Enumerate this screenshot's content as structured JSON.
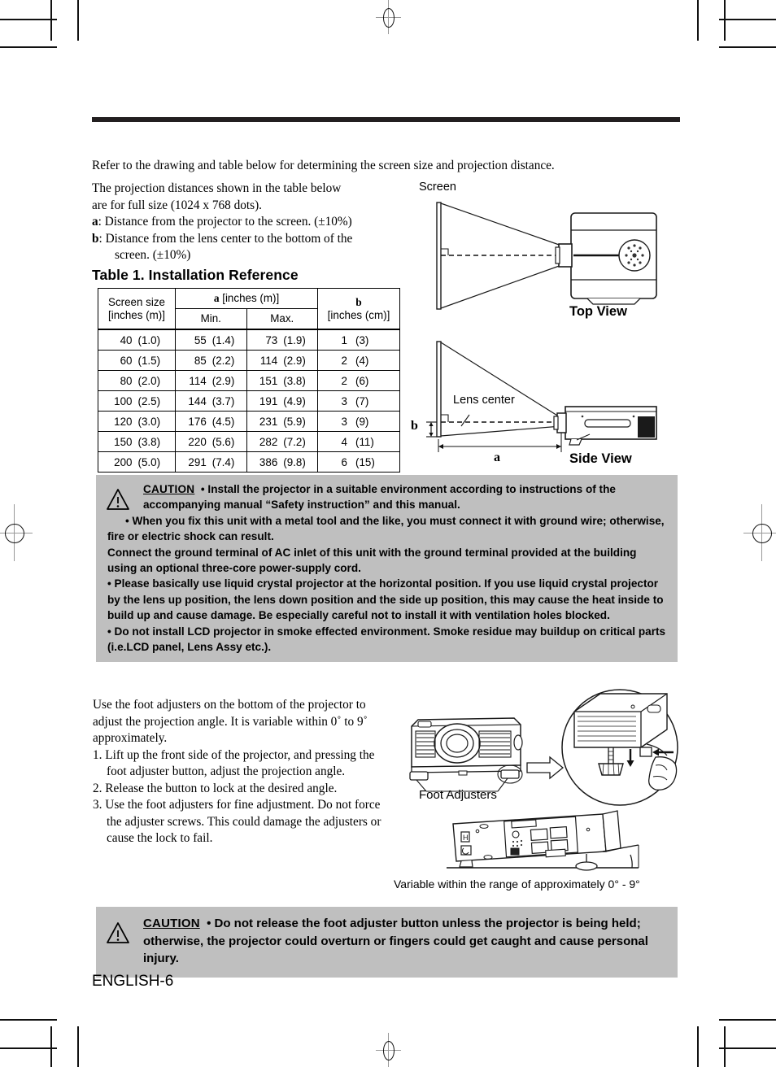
{
  "page": {
    "footer": "ENGLISH-6",
    "intro": "Refer to the drawing and table below for determining the screen size and projection distance."
  },
  "left_intro": {
    "line1": "The projection distances shown in the table below",
    "line2": "are for full size (1024 x 768 dots).",
    "a_label": "a",
    "a_desc": ": Distance from the projector to the screen. (±10%)",
    "b_label": "b",
    "b_desc": ": Distance from the lens center to the bottom of the",
    "b_desc2": "screen. (±10%)"
  },
  "table": {
    "title": "Table 1. Installation Reference",
    "headers": {
      "screen_size_line1": "Screen size",
      "screen_size_line2": "[inches (m)]",
      "a_group_bold": "a",
      "a_group_rest": " [inches (m)]",
      "min": "Min.",
      "max": "Max.",
      "b_bold": "b",
      "b_units": "[inches (cm)]"
    },
    "rows": [
      {
        "screen_n": "40",
        "screen_p": "(1.0)",
        "min_n": "55",
        "min_p": "(1.4)",
        "max_n": "73",
        "max_p": "(1.9)",
        "b_n": "1",
        "b_p": "(3)"
      },
      {
        "screen_n": "60",
        "screen_p": "(1.5)",
        "min_n": "85",
        "min_p": "(2.2)",
        "max_n": "114",
        "max_p": "(2.9)",
        "b_n": "2",
        "b_p": "(4)"
      },
      {
        "screen_n": "80",
        "screen_p": "(2.0)",
        "min_n": "114",
        "min_p": "(2.9)",
        "max_n": "151",
        "max_p": "(3.8)",
        "b_n": "2",
        "b_p": "(6)"
      },
      {
        "screen_n": "100",
        "screen_p": "(2.5)",
        "min_n": "144",
        "min_p": "(3.7)",
        "max_n": "191",
        "max_p": "(4.9)",
        "b_n": "3",
        "b_p": "(7)"
      },
      {
        "screen_n": "120",
        "screen_p": "(3.0)",
        "min_n": "176",
        "min_p": "(4.5)",
        "max_n": "231",
        "max_p": "(5.9)",
        "b_n": "3",
        "b_p": "(9)"
      },
      {
        "screen_n": "150",
        "screen_p": "(3.8)",
        "min_n": "220",
        "min_p": "(5.6)",
        "max_n": "282",
        "max_p": "(7.2)",
        "b_n": "4",
        "b_p": "(11)"
      },
      {
        "screen_n": "200",
        "screen_p": "(5.0)",
        "min_n": "291",
        "min_p": "(7.4)",
        "max_n": "386",
        "max_p": "(9.8)",
        "b_n": "6",
        "b_p": "(15)"
      }
    ]
  },
  "diagrams": {
    "screen_label": "Screen",
    "top_view": "Top View",
    "side_view": "Side View",
    "lens_center": "Lens center",
    "dim_a": "a",
    "dim_b": "b",
    "foot_adjusters": "Foot Adjusters",
    "variable_range": "Variable within the range of approximately 0° - 9°"
  },
  "caution_top": {
    "word": "CAUTION",
    "p1": "• Install the projector in a suitable environment according to instructions of the accompanying manual “Safety instruction” and this manual.",
    "p2": "• When you fix this unit with a metal tool and the like, you must connect it with ground wire; otherwise, fire or electric shock can result.",
    "p3": "Connect the ground terminal of AC inlet of this unit with the ground terminal provided at the building using an optional three-core power-supply cord.",
    "p4": "• Please basically use liquid crystal projector at the horizontal position. If you use liquid crystal projector by the lens up position, the lens down position and the side up position, this may cause the heat inside to build up and cause damage. Be especially careful not to install it with ventilation holes blocked.",
    "p5": "• Do not install LCD projector in smoke effected environment. Smoke residue may buildup on critical parts (i.e.LCD panel, Lens Assy etc.)."
  },
  "instructions": {
    "intro": "Use the foot adjusters on the bottom of the projector to adjust the projection angle. It is variable within 0˚ to 9˚ approximately.",
    "step1": "1. Lift up the front side of the projector, and pressing the foot adjuster button, adjust the projection angle.",
    "step2": "2. Release the button to lock at the desired angle.",
    "step3": "3. Use the foot adjusters for fine adjustment. Do not force the adjuster screws. This could damage the adjusters or cause the lock to fail."
  },
  "caution_bottom": {
    "word": "CAUTION",
    "p1": "• Do not release the foot adjuster button unless the projector is being held; otherwise, the projector could overturn or fingers could get caught and cause personal injury."
  },
  "colors": {
    "rule": "#231f20",
    "caution_bg": "#bfbfbf"
  }
}
